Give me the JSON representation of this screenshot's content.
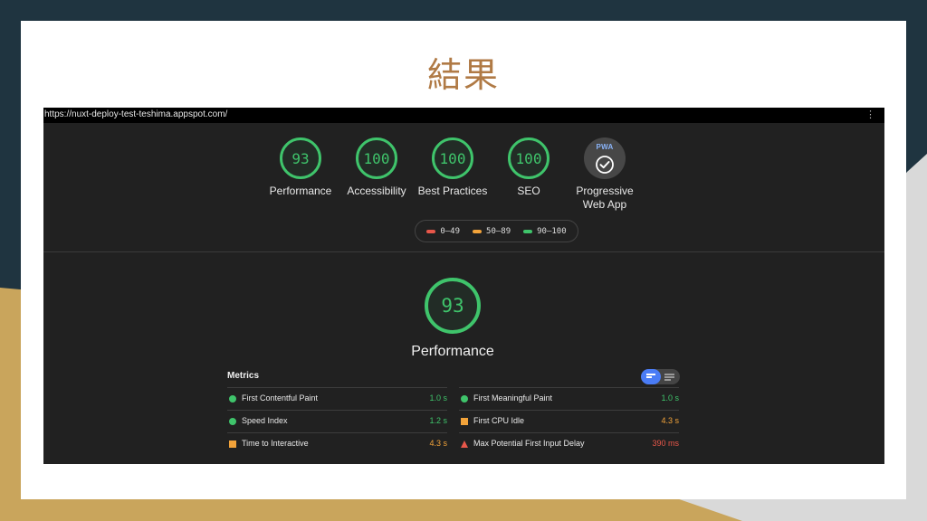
{
  "slide": {
    "title": "結果"
  },
  "browser": {
    "url": "https://nuxt-deploy-test-teshima.appspot.com/",
    "menu_icon": "⋮"
  },
  "summary": {
    "gauges": [
      {
        "score": "93",
        "label": "Performance"
      },
      {
        "score": "100",
        "label": "Accessibility"
      },
      {
        "score": "100",
        "label": "Best Practices"
      },
      {
        "score": "100",
        "label": "SEO"
      }
    ],
    "pwa": {
      "badge_text": "PWA",
      "label_line1": "Progressive",
      "label_line2": "Web App"
    }
  },
  "legend": [
    {
      "range": "0–49",
      "color": "#e8574a"
    },
    {
      "range": "50–89",
      "color": "#f2a33a"
    },
    {
      "range": "90–100",
      "color": "#3fc46b"
    }
  ],
  "performance": {
    "score": "93",
    "label": "Performance"
  },
  "metrics": {
    "title": "Metrics",
    "left": [
      {
        "name": "First Contentful Paint",
        "value": "1.0 s",
        "status": "pass",
        "icon": "circle",
        "color": "#3fc46b"
      },
      {
        "name": "Speed Index",
        "value": "1.2 s",
        "status": "pass",
        "icon": "circle",
        "color": "#3fc46b"
      },
      {
        "name": "Time to Interactive",
        "value": "4.3 s",
        "status": "average",
        "icon": "square",
        "color": "#f2a33a"
      }
    ],
    "right": [
      {
        "name": "First Meaningful Paint",
        "value": "1.0 s",
        "status": "pass",
        "icon": "circle",
        "color": "#3fc46b"
      },
      {
        "name": "First CPU Idle",
        "value": "4.3 s",
        "status": "average",
        "icon": "square",
        "color": "#f2a33a"
      },
      {
        "name": "Max Potential First Input Delay",
        "value": "390 ms",
        "status": "fail",
        "icon": "triangle",
        "color": "#e8574a"
      }
    ]
  },
  "colors": {
    "pass": "#3fc46b",
    "average": "#f2a33a",
    "fail": "#e8574a",
    "title": "#b07a45"
  }
}
